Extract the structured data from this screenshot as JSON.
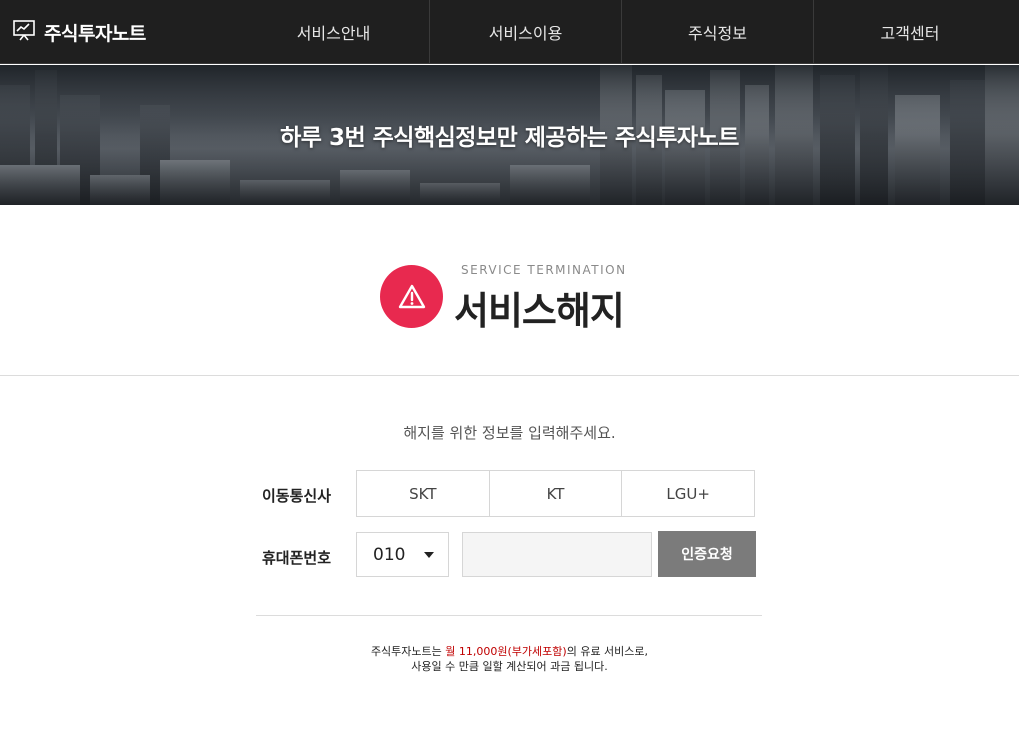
{
  "header": {
    "logo_text": "주식투자노트",
    "nav": [
      "서비스안내",
      "서비스이용",
      "주식정보",
      "고객센터"
    ]
  },
  "banner": {
    "title": "하루 3번 주식핵심정보만 제공하는 주식투자노트"
  },
  "page": {
    "subtitle": "SERVICE TERMINATION",
    "title": "서비스해지",
    "instruction": "해지를 위한 정보를 입력해주세요."
  },
  "form": {
    "carrier_label": "이동통신사",
    "carriers": [
      "SKT",
      "KT",
      "LGU+"
    ],
    "phone_label": "휴대폰번호",
    "phone_prefix": "010",
    "phone_value": "",
    "auth_button": "인증요청"
  },
  "notice": {
    "line1_prefix": "주식투자노트는 ",
    "line1_price": "월 11,000원(부가세포함)",
    "line1_suffix": "의 유료 서비스로,",
    "line2": "사용일 수 만큼 일할 계산되어 과금 됩니다."
  },
  "colors": {
    "header_bg": "#1f1f1f",
    "accent_red": "#e8294f",
    "button_gray": "#7b7b7b",
    "price_red": "#c00000"
  }
}
